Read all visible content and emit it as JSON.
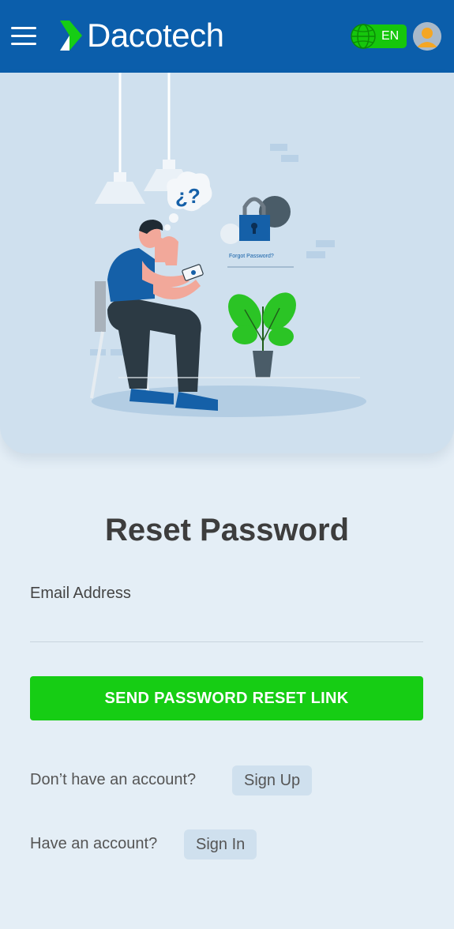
{
  "header": {
    "brand": "Dacotech",
    "language": "EN"
  },
  "hero": {
    "thought_bubble": "¿?",
    "phone_caption": "Forgot Password?"
  },
  "form": {
    "title": "Reset Password",
    "email_label": "Email Address",
    "email_value": "",
    "submit_label": "SEND PASSWORD RESET LINK"
  },
  "links": {
    "signup_prompt": "Don’t have an account?",
    "signup_label": "Sign Up",
    "signin_prompt": "Have an account?",
    "signin_label": "Sign In"
  },
  "colors": {
    "header_bg": "#0b5eab",
    "accent_green": "#16cd14",
    "page_bg": "#e4eef6"
  }
}
